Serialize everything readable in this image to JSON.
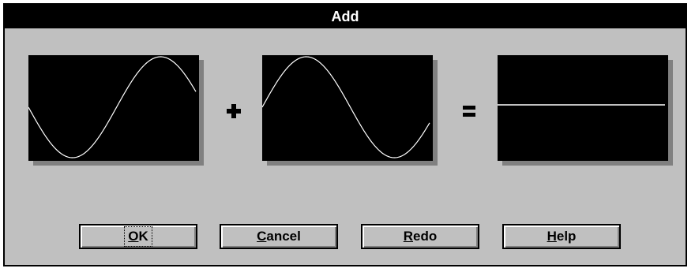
{
  "dialog": {
    "title": "Add",
    "panels": [
      {
        "name": "input-a",
        "waveform": "sine",
        "phase": "starts mid, dips to minimum, rises to peak"
      },
      {
        "name": "input-b",
        "waveform": "sine",
        "phase": "starts mid, rises to peak, dips to minimum"
      },
      {
        "name": "result",
        "waveform": "flat",
        "phase": "constant zero line"
      }
    ],
    "operators": {
      "plus": "+",
      "equals": "="
    },
    "buttons": {
      "ok": {
        "mnemonic": "O",
        "rest": "K",
        "full": "OK"
      },
      "cancel": {
        "mnemonic": "C",
        "rest": "ancel",
        "full": "Cancel"
      },
      "redo": {
        "mnemonic": "R",
        "rest": "edo",
        "full": "Redo"
      },
      "help": {
        "mnemonic": "H",
        "rest": "elp",
        "full": "Help"
      }
    },
    "colors": {
      "face": "#c0c0c0",
      "scope": "#000000",
      "trace": "#ffffff",
      "shadow": "#808080"
    }
  }
}
